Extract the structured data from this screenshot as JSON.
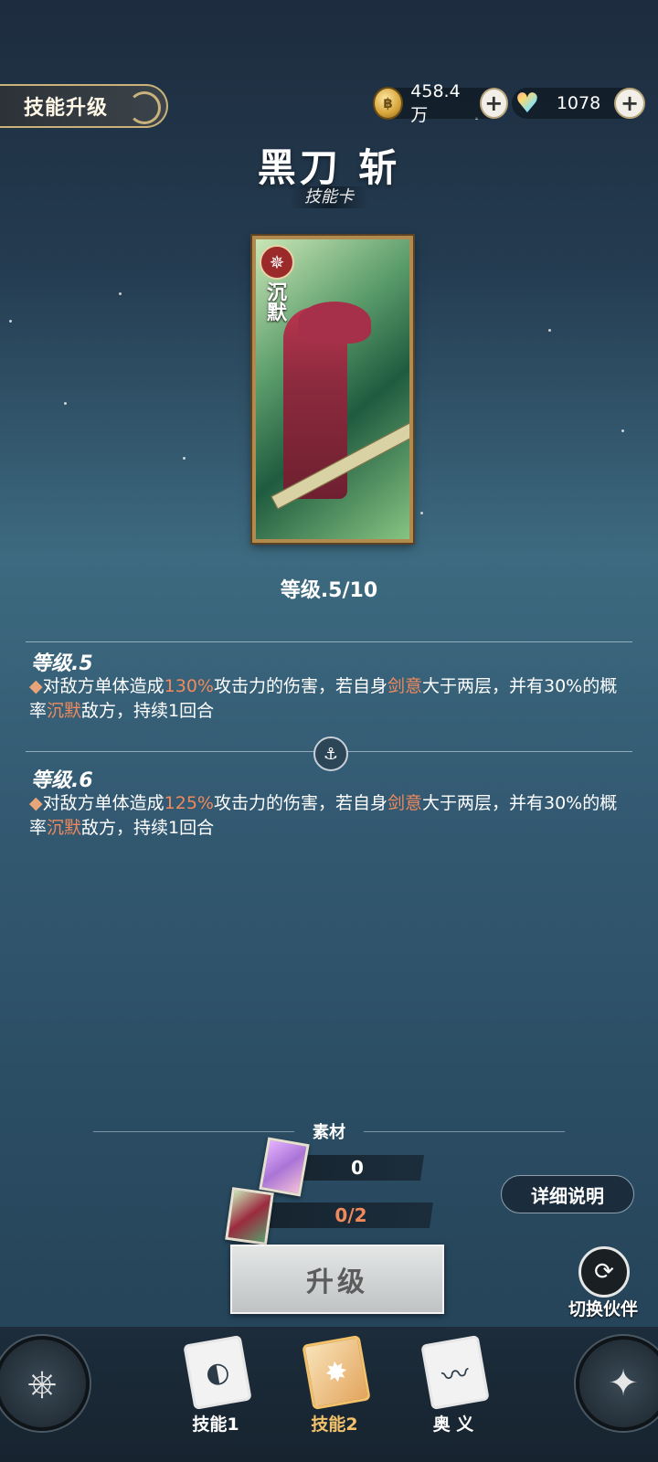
{
  "header": {
    "page_title": "技能升级",
    "gold_value": "458.4万",
    "gem_value": "1078"
  },
  "skill": {
    "name": "黑刀 斩",
    "type": "技能卡",
    "card_tag": "沉默",
    "level": "等级.5/10"
  },
  "levels": [
    {
      "title": "等级.5",
      "desc_parts": [
        "对敌方单体造成",
        "130%",
        "攻击力的伤害，若自身",
        "剑意",
        "大于两层，并有30%的概率",
        "沉默",
        "敌方，持续1回合"
      ]
    },
    {
      "title": "等级.6",
      "desc_parts": [
        "对敌方单体造成",
        "125%",
        "攻击力的伤害，若自身",
        "剑意",
        "大于两层，并有30%的概率",
        "沉默",
        "敌方，持续1回合"
      ]
    }
  ],
  "materials": {
    "title": "素材",
    "item1_count": "0",
    "item2_count": "0/2"
  },
  "buttons": {
    "upgrade": "升级",
    "detail": "详细说明",
    "switch_partner": "切换伙伴"
  },
  "nav": {
    "tabs": [
      {
        "label": "技能1",
        "active": false
      },
      {
        "label": "技能2",
        "active": true
      },
      {
        "label": "奥 义",
        "active": false
      }
    ]
  },
  "colors": {
    "highlight": "#f08a5d",
    "active_tab": "#f2c16a",
    "gold_border": "#c9b37a"
  },
  "icons": [
    "coin-icon",
    "plus-icon",
    "gem-icon",
    "ship-wheel-icon",
    "anchor-icon",
    "switch-icon",
    "helm-icon",
    "compass-icon"
  ]
}
